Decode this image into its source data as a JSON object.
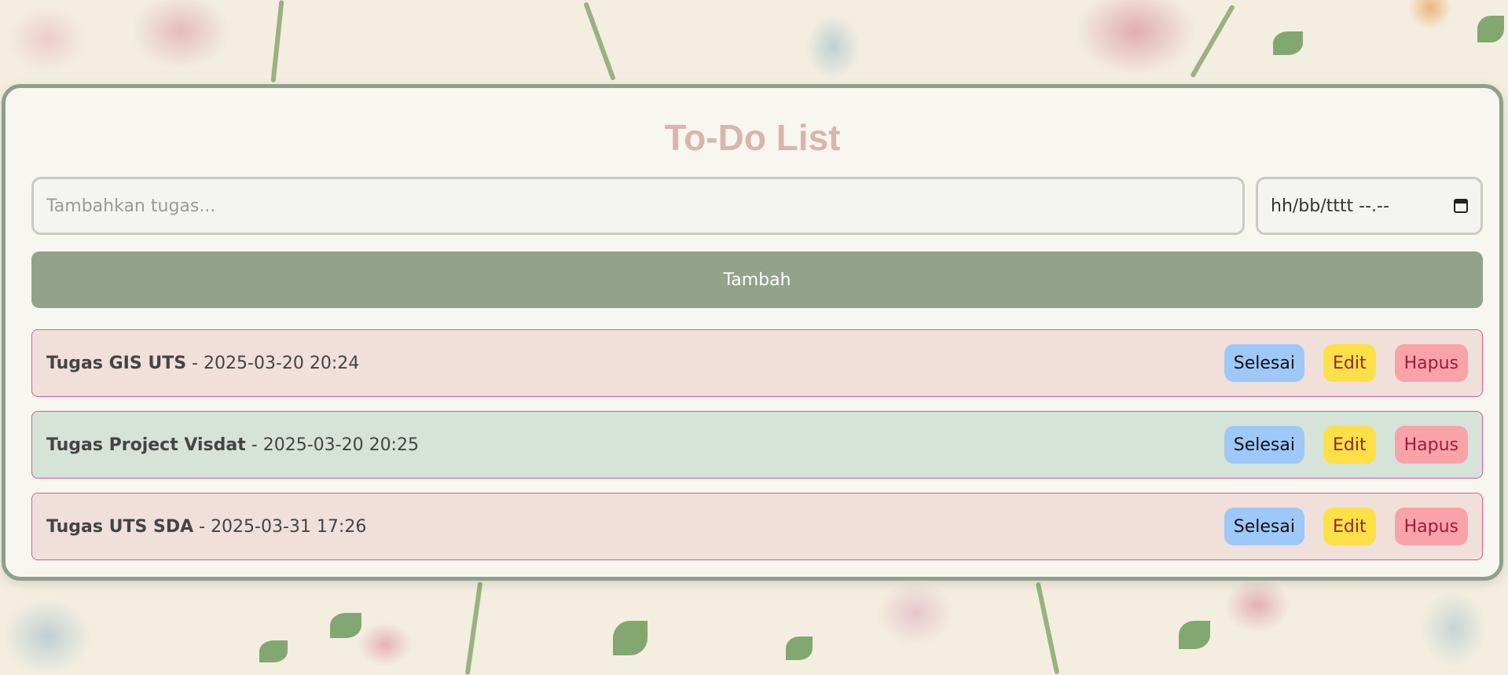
{
  "app": {
    "title": "To-Do List"
  },
  "form": {
    "task_placeholder": "Tambahkan tugas...",
    "task_value": "",
    "date_placeholder": "hh/bb/tttt --.--",
    "add_label": "Tambah"
  },
  "tasks": [
    {
      "name": "Tugas GIS UTS",
      "separator": "-",
      "datetime": "2025-03-20 20:24",
      "state": "pending"
    },
    {
      "name": "Tugas Project Visdat",
      "separator": "-",
      "datetime": "2025-03-20 20:25",
      "state": "done"
    },
    {
      "name": "Tugas UTS SDA",
      "separator": "-",
      "datetime": "2025-03-31 17:26",
      "state": "pending"
    }
  ],
  "actions": {
    "done_label": "Selesai",
    "edit_label": "Edit",
    "delete_label": "Hapus"
  },
  "icons": {
    "date_picker": "calendar-icon"
  },
  "colors": {
    "title": "#d8b5ad",
    "add_button": "#92a28b",
    "card_border": "#8fa08a",
    "pending_row": "#f1dfda",
    "done_row": "#d5e3d8",
    "row_border": "#e0559a",
    "done_button": "#9ec8f7",
    "edit_button": "#fde047",
    "delete_button": "#f9a3a8"
  }
}
